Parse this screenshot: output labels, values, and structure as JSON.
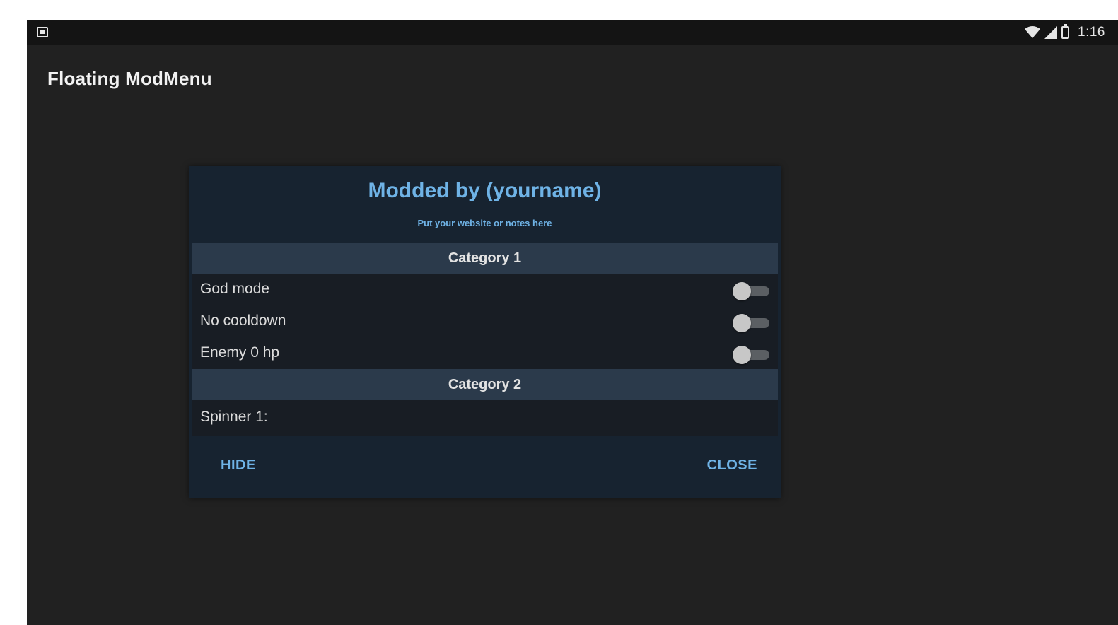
{
  "status_bar": {
    "time": "1:16",
    "icons": [
      "notification-icon",
      "wifi-icon",
      "signal-icon",
      "battery-icon"
    ]
  },
  "app_bar": {
    "title": "Floating ModMenu"
  },
  "mod_menu": {
    "title": "Modded by (yourname)",
    "subtitle": "Put your website or notes here",
    "categories": [
      {
        "label": "Category 1",
        "toggles": [
          {
            "label": "God mode",
            "on": false
          },
          {
            "label": "No cooldown",
            "on": false
          },
          {
            "label": "Enemy 0 hp",
            "on": false
          }
        ]
      },
      {
        "label": "Category 2",
        "spinner_label": "Spinner 1:"
      }
    ],
    "buttons": {
      "hide": "HIDE",
      "close": "CLOSE"
    },
    "colors": {
      "accent": "#6fb3e6",
      "panel": "#172330",
      "category": "#2b3a4b"
    }
  }
}
